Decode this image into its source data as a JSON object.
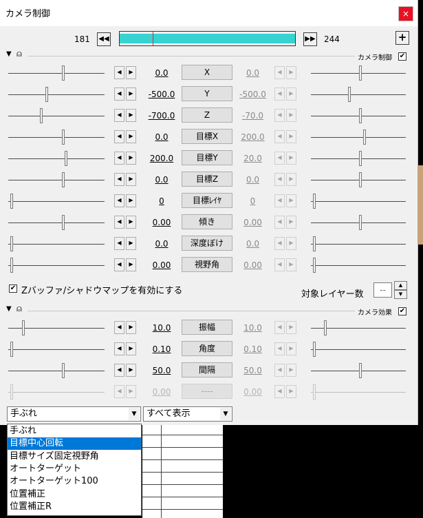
{
  "window": {
    "title": "カメラ制御",
    "close_label": "×"
  },
  "timeline": {
    "start": "181",
    "end": "244",
    "prev_label": "◀◀",
    "next_label": "▶▶",
    "add_label": "+",
    "progress": 0.19,
    "cursor_color": "#e03030",
    "bar_color": "#37d2d2"
  },
  "camera_control": {
    "label": "カメラ制御",
    "checked": true
  },
  "camera_effect": {
    "label": "カメラ効果",
    "checked": true
  },
  "params": [
    {
      "label": "X",
      "left_value": "0.0",
      "right_value": "0.0",
      "left_pos": 0.57,
      "right_pos": 0.52
    },
    {
      "label": "Y",
      "left_value": "-500.0",
      "right_value": "-500.0",
      "left_pos": 0.4,
      "right_pos": 0.4
    },
    {
      "label": "Z",
      "left_value": "-700.0",
      "right_value": "-70.0",
      "left_pos": 0.34,
      "right_pos": 0.52
    },
    {
      "label": "目標X",
      "left_value": "0.0",
      "right_value": "200.0",
      "left_pos": 0.57,
      "right_pos": 0.57
    },
    {
      "label": "目標Y",
      "left_value": "200.0",
      "right_value": "20.0",
      "left_pos": 0.6,
      "right_pos": 0.52
    },
    {
      "label": "目標Z",
      "left_value": "0.0",
      "right_value": "0.0",
      "left_pos": 0.57,
      "right_pos": 0.52
    },
    {
      "label": "目標ﾚｲﾔ",
      "left_value": "0",
      "right_value": "0",
      "left_pos": 0.02,
      "right_pos": 0.02
    },
    {
      "label": "傾き",
      "left_value": "0.00",
      "right_value": "0.00",
      "left_pos": 0.57,
      "right_pos": 0.52
    },
    {
      "label": "深度ぼけ",
      "left_value": "0.0",
      "right_value": "0.0",
      "left_pos": 0.02,
      "right_pos": 0.02
    },
    {
      "label": "視野角",
      "left_value": "0.00",
      "right_value": "0.00",
      "left_pos": 0.02,
      "right_pos": 0.02
    }
  ],
  "zbuffer": {
    "label": "Zバッファ/シャドウマップを有効にする",
    "checked": true
  },
  "target_layers": {
    "label": "対象レイヤー数",
    "value": "--"
  },
  "effect_params": [
    {
      "label": "振幅",
      "left_value": "10.0",
      "right_value": "10.0",
      "left_pos": 0.15,
      "right_pos": 0.14,
      "enabled": true
    },
    {
      "label": "角度",
      "left_value": "0.10",
      "right_value": "0.10",
      "left_pos": 0.02,
      "right_pos": 0.02,
      "enabled": true
    },
    {
      "label": "間隔",
      "left_value": "50.0",
      "right_value": "50.0",
      "left_pos": 0.57,
      "right_pos": 0.52,
      "enabled": true
    },
    {
      "label": "----",
      "left_value": "0.00",
      "right_value": "0.00",
      "left_pos": 0.02,
      "right_pos": 0.02,
      "enabled": false
    }
  ],
  "effect_select": {
    "value": "手ぶれ"
  },
  "display_select": {
    "value": "すべて表示"
  },
  "dropdown_options": [
    {
      "label": "手ぶれ",
      "selected": false
    },
    {
      "label": "目標中心回転",
      "selected": true
    },
    {
      "label": "目標サイズ固定視野角",
      "selected": false
    },
    {
      "label": "オートターゲット",
      "selected": false
    },
    {
      "label": "オートターゲット100",
      "selected": false
    },
    {
      "label": "位置補正",
      "selected": false
    },
    {
      "label": "位置補正R",
      "selected": false
    }
  ]
}
